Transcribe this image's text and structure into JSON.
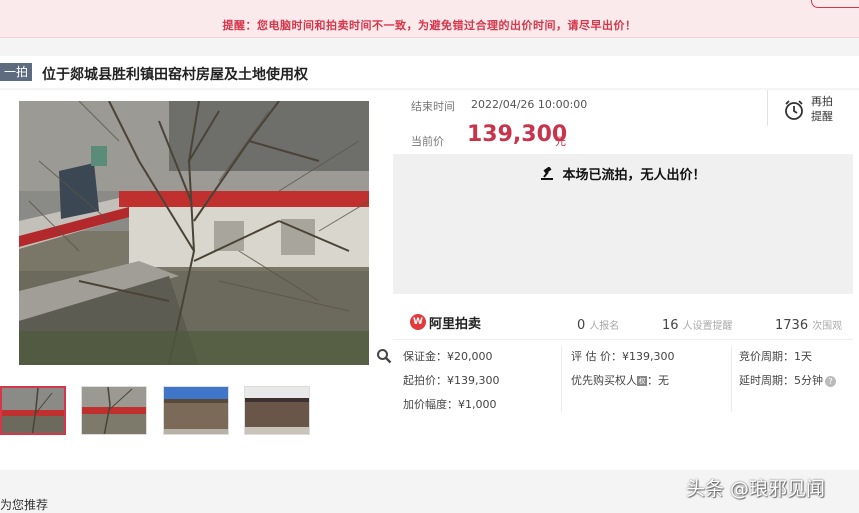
{
  "notice": {
    "text": "提醒：您电脑时间和拍卖时间不一致，为避免错过合理的出价时间，请尽早出价！"
  },
  "header": {
    "badge": "一拍",
    "title": "位于郯城县胜利镇田窑村房屋及土地使用权"
  },
  "auction": {
    "end_label": "结束时间",
    "end_time": "2022/04/26 10:00:00",
    "price_label": "当前价",
    "price": "139,300",
    "price_unit": "元",
    "remind_label": "再拍提醒",
    "status": "本场已流拍，无人出价！"
  },
  "platform": {
    "logo_text": "阿里拍卖",
    "logo_badge": "W"
  },
  "stats": [
    {
      "num": "0",
      "label": "人报名"
    },
    {
      "num": "16",
      "label": "人设置提醒"
    },
    {
      "num": "1736",
      "label": "次围观"
    }
  ],
  "details": {
    "deposit": "保证金：¥20,000",
    "start_price": "起拍价：¥139,300",
    "increment": "加价幅度：¥1,000",
    "appraisal": "评 估 价：¥139,300",
    "priority": "优先购买权人",
    "priority_value": "：无",
    "cycle": "竞价周期：1天",
    "delay": "延时周期：5分钟",
    "help_glyph": "?"
  },
  "recommend": {
    "title": "为您推荐"
  },
  "watermark": {
    "text": "头条 @琅邪见闻"
  },
  "colors": {
    "accent": "#c8344b",
    "notice_bg": "#fbeaec",
    "badge_bg": "#5c6b80"
  }
}
